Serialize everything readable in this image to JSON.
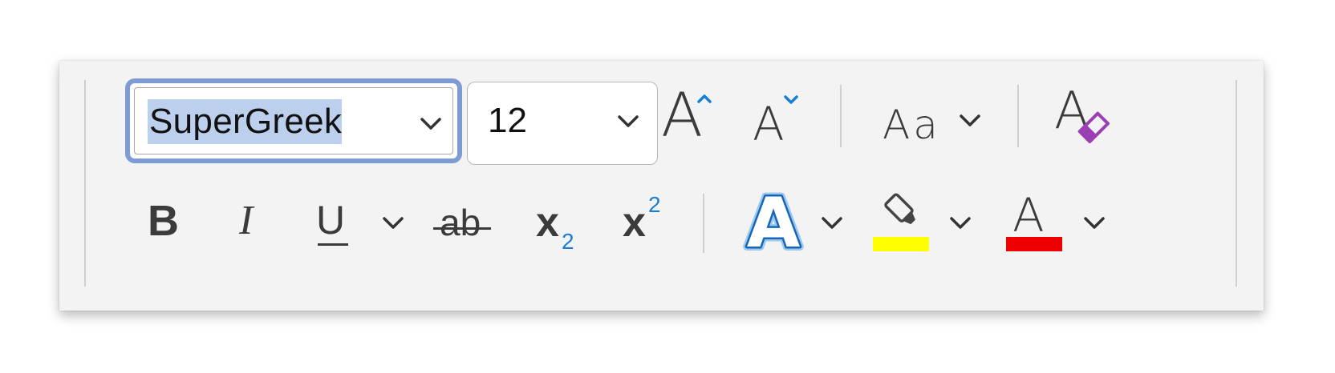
{
  "font_name": {
    "value": "SuperGreek",
    "selected": true
  },
  "font_size": {
    "value": "12"
  },
  "grow_font": {
    "glyph": "A"
  },
  "shrink_font": {
    "glyph": "A"
  },
  "change_case": {
    "glyph": "Aa"
  },
  "clear_formatting": {
    "glyph": "A"
  },
  "bold": {
    "glyph": "B"
  },
  "italic": {
    "glyph": "I"
  },
  "underline": {
    "glyph": "U"
  },
  "strikethrough": {
    "glyph": "ab"
  },
  "subscript": {
    "glyph": "x",
    "sub": "2"
  },
  "superscript": {
    "glyph": "x",
    "sup": "2"
  },
  "text_effects": {
    "glyph": "A"
  },
  "highlight": {
    "color": "#ffff00"
  },
  "font_color": {
    "glyph": "A",
    "color": "#ee0000"
  },
  "colors": {
    "accent_blue": "#1a7fd4",
    "eraser_purple": "#9b3fb5",
    "selection": "#bcd0ee"
  }
}
